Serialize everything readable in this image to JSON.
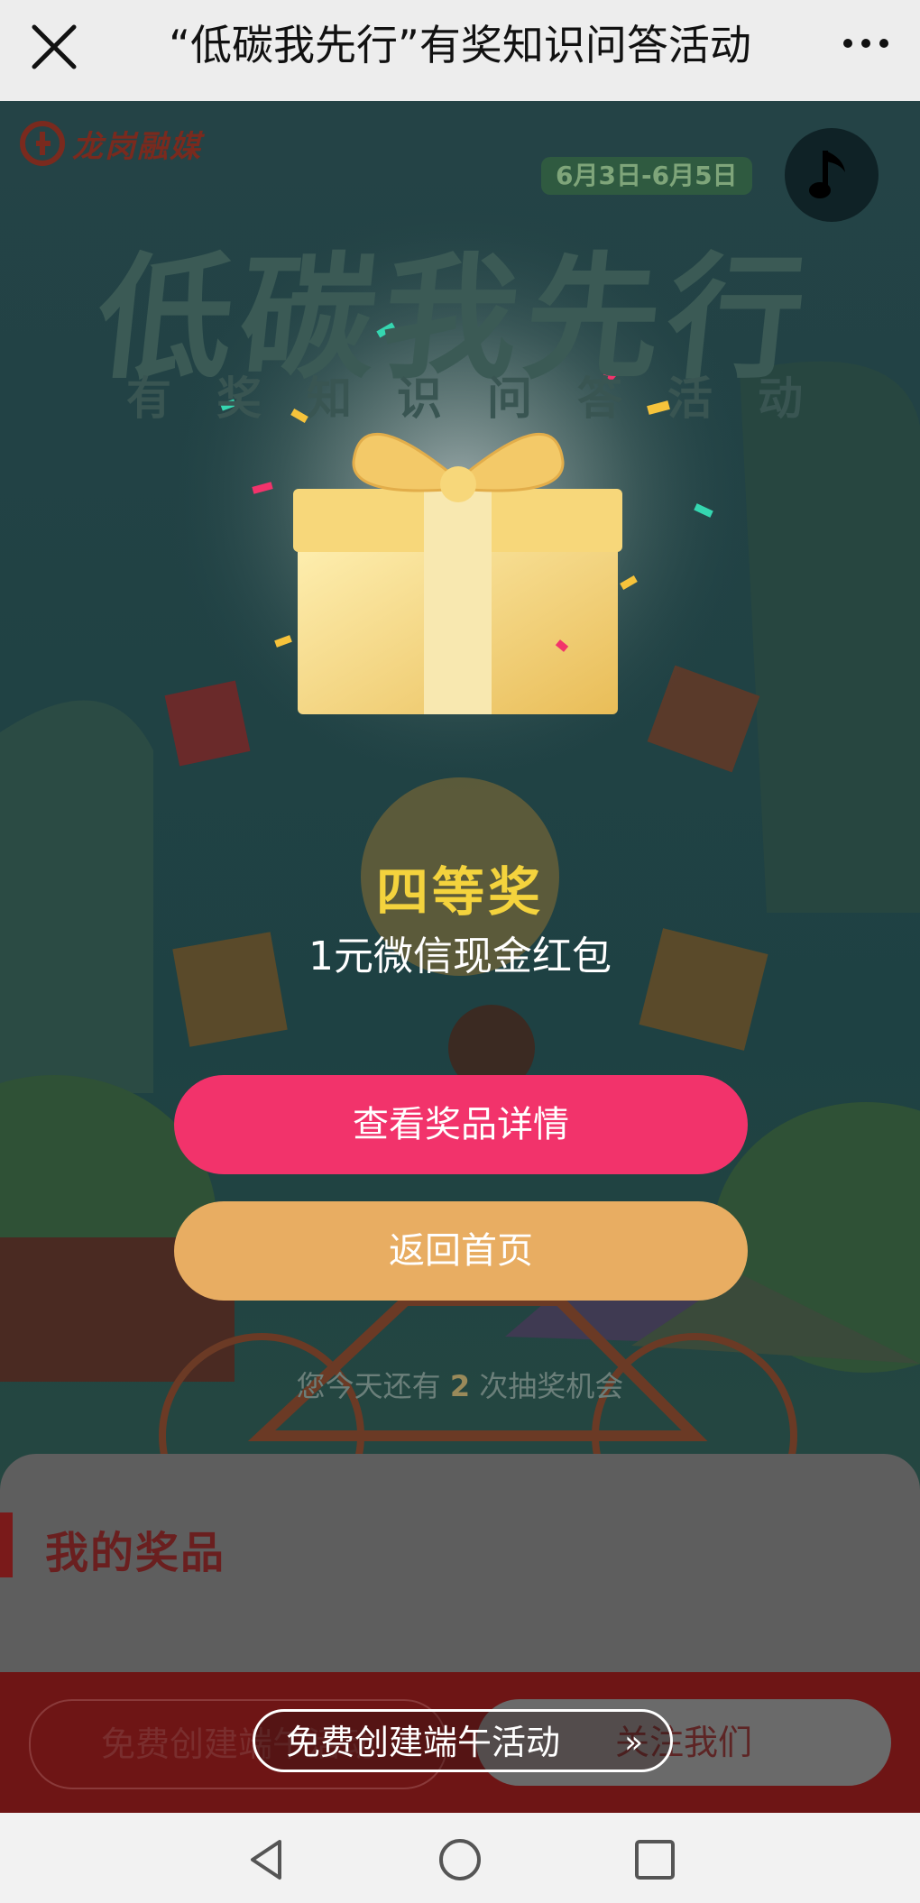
{
  "header": {
    "title": "“低碳我先行”有奖知识问答活动"
  },
  "poster": {
    "logo_text": "龙岗融媒",
    "date_range": "6月3日-6月5日",
    "title": "低碳我先行",
    "subtitle": "有奖知识问答活动"
  },
  "prize": {
    "level": "四等奖",
    "name": "1元微信现金红包"
  },
  "buttons": {
    "view_details": "查看奖品详情",
    "back_home": "返回首页"
  },
  "chance": {
    "prefix": "您今天还有",
    "count": "2",
    "suffix": "次抽奖机会"
  },
  "my_prizes": {
    "title": "我的奖品"
  },
  "footer": {
    "left": "免费创建端午活动",
    "right": "关注我们"
  },
  "toast": {
    "text": "免费创建端午活动",
    "arrow": "»"
  },
  "colors": {
    "primary": "#f2336b",
    "secondary": "#e8ad62",
    "gold": "#f4d33d"
  }
}
